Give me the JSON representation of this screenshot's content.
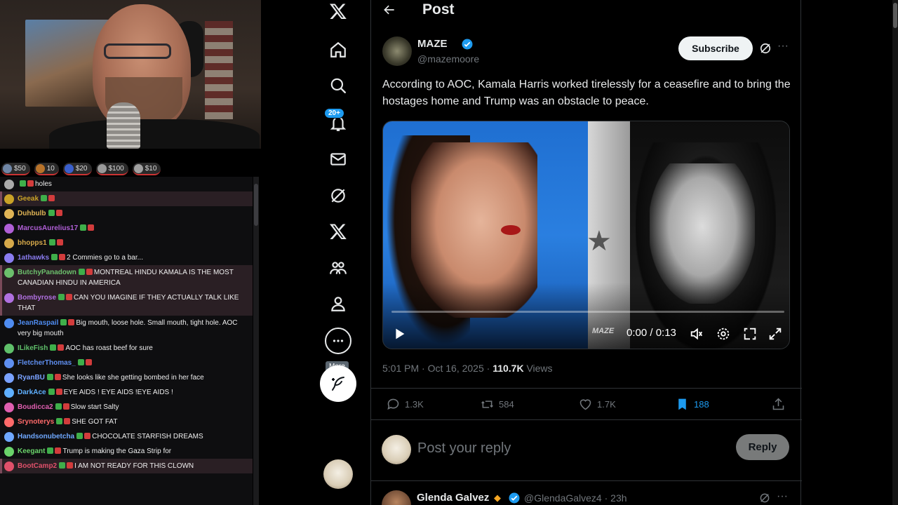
{
  "stream": {
    "donations": [
      {
        "label": "$50",
        "color": "#6f86a6"
      },
      {
        "label": "10",
        "color": "#b8732a"
      },
      {
        "label": "$20",
        "color": "#3a5fcc"
      },
      {
        "label": "$100",
        "color": "#9a9a9a"
      },
      {
        "label": "$10",
        "color": "#a0a0a0"
      }
    ],
    "chat": [
      {
        "user": "",
        "msg": "holes",
        "color": "#aaaaaa",
        "hl": false
      },
      {
        "user": "Geeak",
        "msg": "",
        "color": "#c9a227",
        "hl": true
      },
      {
        "user": "Duhbulb",
        "msg": "",
        "color": "#e0b455",
        "hl": false
      },
      {
        "user": "MarcusAurelius17",
        "msg": "",
        "color": "#b05fd6",
        "hl": false
      },
      {
        "user": "bhopps1",
        "msg": "",
        "color": "#d6a94a",
        "hl": false
      },
      {
        "user": "1athawks",
        "msg": "2 Commies go to a bar...",
        "color": "#8a7cf0",
        "hl": false
      },
      {
        "user": "ButchyPanadown",
        "msg": "MONTREAL HINDU KAMALA IS THE MOST CANADIAN HINDU IN AMERICA",
        "color": "#6cbf6c",
        "hl": true
      },
      {
        "user": "Bombyrose",
        "msg": "CAN YOU IMAGINE IF THEY ACTUALLY TALK LIKE THAT",
        "color": "#b070e0",
        "hl": true
      },
      {
        "user": "JeanRaspail",
        "msg": "Big mouth, loose hole. Small mouth, tight hole. AOC very big mouth",
        "color": "#4f8cf0",
        "hl": false
      },
      {
        "user": "ILikeFish",
        "msg": "AOC has roast beef for sure",
        "color": "#5fc06a",
        "hl": false
      },
      {
        "user": "FletcherThomas_",
        "msg": "",
        "color": "#5f8ff0",
        "hl": false
      },
      {
        "user": "RyanBU",
        "msg": "She looks like she getting bombed in her face",
        "color": "#7aa2ff",
        "hl": false
      },
      {
        "user": "DarkAce",
        "msg": "EYE AIDS ! EYE AIDS !EYE AIDS !",
        "color": "#5fb0ff",
        "hl": false
      },
      {
        "user": "Boudicca2",
        "msg": "Slow start Salty",
        "color": "#e05fb0",
        "hl": false
      },
      {
        "user": "Srynoterys",
        "msg": "SHE GOT FAT",
        "color": "#ff6a6a",
        "hl": false
      },
      {
        "user": "Handsonubetcha",
        "msg": "CHOCOLATE STARFISH DREAMS",
        "color": "#6fa8ff",
        "hl": false
      },
      {
        "user": "Keegant",
        "msg": "Trump is making the Gaza Strip for",
        "color": "#6ad36a",
        "hl": false
      },
      {
        "user": "BootCamp2",
        "msg": "I AM NOT READY FOR THIS CLOWN",
        "color": "#e0506a",
        "hl": true
      }
    ]
  },
  "nav": {
    "notifications_badge": "20+",
    "more_tooltip": "More"
  },
  "post": {
    "header_title": "Post",
    "author": {
      "name": "MAZE",
      "handle": "@mazemoore"
    },
    "subscribe_label": "Subscribe",
    "text": "According to AOC, Kamala Harris worked tirelessly for a ceasefire and to bring the hostages home and Trump was an obstacle to peace.",
    "video": {
      "watermark": "MAZE",
      "time": "0:00 / 0:13",
      "progress": 0
    },
    "meta": {
      "timestamp": "5:01 PM · Oct 16, 2025 · ",
      "views_count": "110.7K",
      "views_label": " Views"
    },
    "stats": {
      "replies": "1.3K",
      "reposts": "584",
      "likes": "1.7K",
      "bookmarks": "188"
    },
    "reply_placeholder": "Post your reply",
    "reply_button": "Reply"
  },
  "next_reply": {
    "name": "Glenda Galvez",
    "handle": "@GlendaGalvez4 · 23h"
  },
  "colors": {
    "accent": "#1d9bf0",
    "text": "#e7e9ea",
    "muted": "#71767b",
    "border": "#2f3336"
  }
}
